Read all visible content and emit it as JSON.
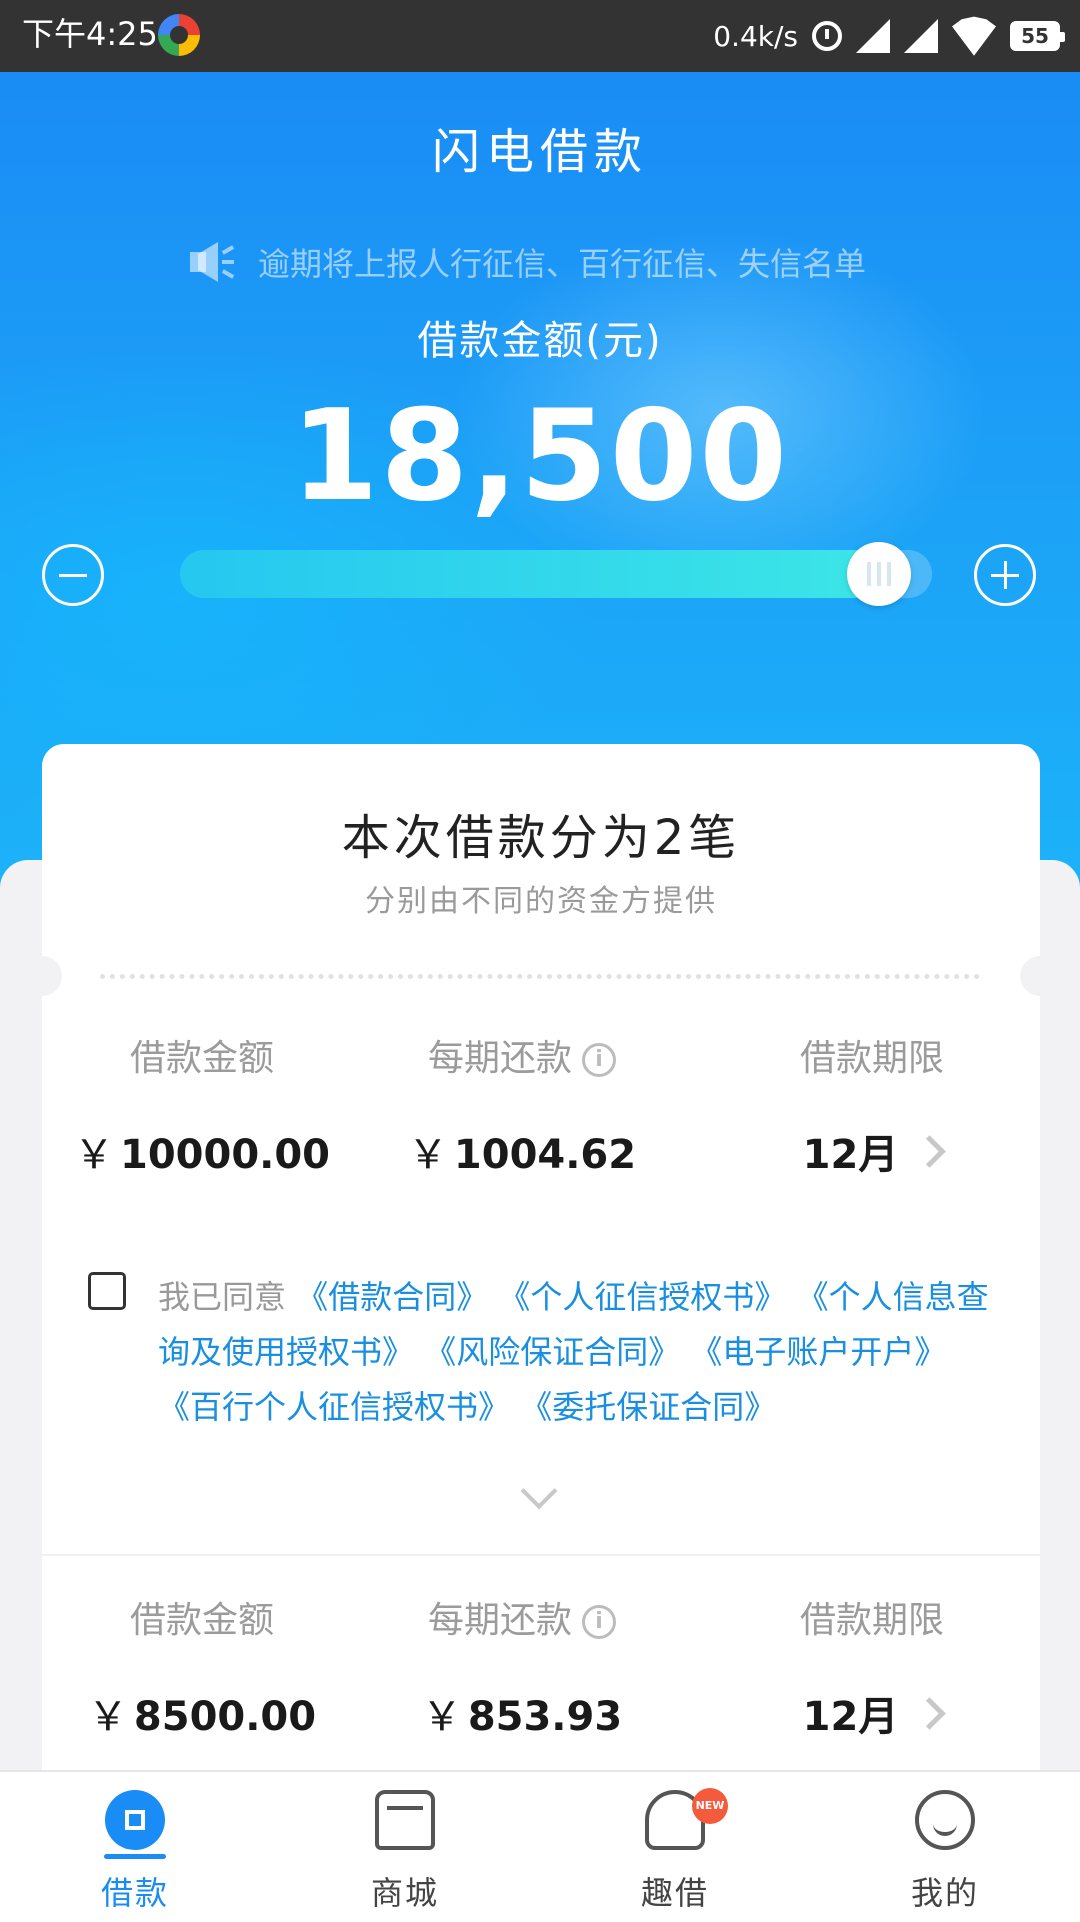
{
  "status_bar": {
    "time": "下午4:25",
    "network_speed": "0.4k/s",
    "battery": "55"
  },
  "header": {
    "title": "闪电借款",
    "notice": "逾期将上报人行征信、百行征信、失信名单",
    "amount_label": "借款金额(元)",
    "amount_value": "18,500"
  },
  "slider": {
    "fill_fraction": 0.93
  },
  "card": {
    "title": "本次借款分为2笔",
    "subtitle": "分别由不同的资金方提供",
    "loans": [
      {
        "amount_label": "借款金额",
        "amount_value": "10000.00",
        "repay_label": "每期还款",
        "repay_value": "1004.62",
        "term_label": "借款期限",
        "term_value": "12月"
      },
      {
        "amount_label": "借款金额",
        "amount_value": "8500.00",
        "repay_label": "每期还款",
        "repay_value": "853.93",
        "term_label": "借款期限",
        "term_value": "12月"
      }
    ],
    "currency_symbol": "￥",
    "agreement": {
      "prefix": "我已同意",
      "links": [
        "《借款合同》",
        "《个人征信授权书》",
        "《个人信息查询及使用授权书》",
        "《风险保证合同》",
        "《电子账户开户》",
        "《百行个人征信授权书》",
        "《委托保证合同》"
      ]
    }
  },
  "bottom_nav": {
    "items": [
      {
        "label": "借款",
        "icon": "loan-icon",
        "active": true
      },
      {
        "label": "商城",
        "icon": "store-icon",
        "active": false
      },
      {
        "label": "趣借",
        "icon": "fun-loan-icon",
        "badge": "NEW",
        "active": false
      },
      {
        "label": "我的",
        "icon": "profile-icon",
        "active": false
      }
    ]
  },
  "colors": {
    "accent": "#1a8cf5",
    "link": "#1a8fe0",
    "badge": "#f45b3c"
  }
}
